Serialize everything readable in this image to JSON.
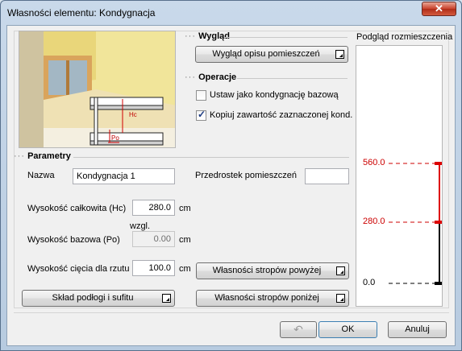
{
  "window": {
    "title": "Własności elementu: Kondygnacja",
    "close_label": "✕"
  },
  "sections": {
    "appearance": "Wygląd",
    "operations": "Operacje",
    "parameters": "Parametry"
  },
  "buttons": {
    "room_description_appearance": "Wygląd opisu pomieszczeń",
    "floor_ceiling_composition": "Skład podłogi i sufitu",
    "ceiling_above": "Własności stropów powyżej",
    "ceiling_below": "Własności stropów poniżej",
    "ok": "OK",
    "cancel": "Anuluj"
  },
  "checkboxes": {
    "set_base": {
      "label": "Ustaw jako kondygnację bazową",
      "checked": false
    },
    "copy_content": {
      "label": "Kopiuj zawartość zaznaczonej kond.",
      "checked": true
    }
  },
  "fields": {
    "name": {
      "label": "Nazwa",
      "value": "Kondygnacja 1"
    },
    "room_prefix": {
      "label": "Przedrostek pomieszczeń",
      "value": ""
    },
    "total_height": {
      "label": "Wysokość całkowita (Hc)",
      "value": "280.0",
      "unit": "cm"
    },
    "base_height": {
      "label": "Wysokość bazowa (Po)",
      "value": "0.00",
      "unit": "cm",
      "note": "wzgl."
    },
    "cut_height": {
      "label": "Wysokość cięcia dla rzutu",
      "value": "100.0",
      "unit": "cm"
    }
  },
  "diagram_labels": {
    "hc": "Hc",
    "po": "Po"
  },
  "placement_preview": {
    "title": "Podgląd rozmieszczenia",
    "levels": [
      {
        "value": "560.0",
        "color": "#cc0000"
      },
      {
        "value": "280.0",
        "color": "#cc0000"
      },
      {
        "value": "0.0",
        "color": "#000000"
      }
    ],
    "colors": {
      "current": "#dd0000",
      "base": "#000000"
    }
  }
}
